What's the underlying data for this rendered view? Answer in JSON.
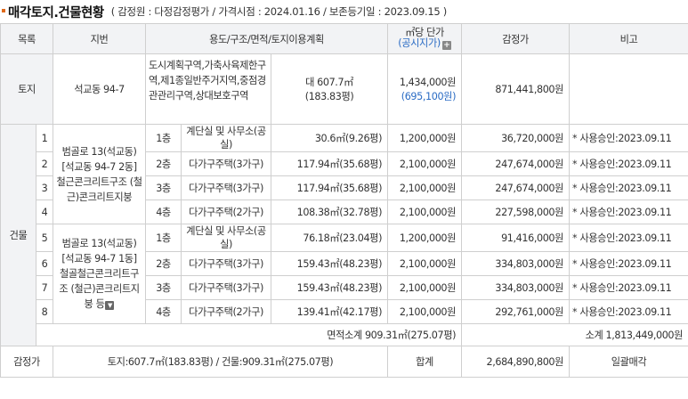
{
  "header": {
    "title": "매각토지.건물현황",
    "meta": "( 감정원 : 다정감정평가 / 가격시점 : 2024.01.16 / 보존등기일 : 2023.09.15 )"
  },
  "columns": {
    "catalog": "목록",
    "lot": "지번",
    "usage": "용도/구조/면적/토지이용계획",
    "unit_price": "㎡당 단가",
    "unit_price_sub": "(공시지가)",
    "appraisal": "감정가",
    "note": "비고"
  },
  "land": {
    "label": "토지",
    "lot": "석교동 94-7",
    "zoning": "도시계획구역,가축사육제한구역,제1종일반주거지역,중점경관관리구역,상대보호구역",
    "area": "대 607.7㎡",
    "area_pyeong": "(183.83평)",
    "unit_price": "1,434,000원",
    "official_price": "(695,100원)",
    "appraisal": "871,441,800원",
    "note": ""
  },
  "building": {
    "label": "건물",
    "group1_address": "범골로 13(석교동) [석교동 94-7 2동] 철근콘크리트구조 (철근)콘크리트지붕",
    "group2_address": "범골로 13(석교동) [석교동 94-7 1동] 철골철근콘크리트구조 (철근)콘크리트지붕 등",
    "rows": [
      {
        "no": "1",
        "floor": "1층",
        "use": "계단실 및 사무소(공실)",
        "area": "30.6㎡(9.26평)",
        "unit": "1,200,000원",
        "value": "36,720,000원",
        "note": "* 사용승인:2023.09.11"
      },
      {
        "no": "2",
        "floor": "2층",
        "use": "다가구주택(3가구)",
        "area": "117.94㎡(35.68평)",
        "unit": "2,100,000원",
        "value": "247,674,000원",
        "note": "* 사용승인:2023.09.11"
      },
      {
        "no": "3",
        "floor": "3층",
        "use": "다가구주택(3가구)",
        "area": "117.94㎡(35.68평)",
        "unit": "2,100,000원",
        "value": "247,674,000원",
        "note": "* 사용승인:2023.09.11"
      },
      {
        "no": "4",
        "floor": "4층",
        "use": "다가구주택(2가구)",
        "area": "108.38㎡(32.78평)",
        "unit": "2,100,000원",
        "value": "227,598,000원",
        "note": "* 사용승인:2023.09.11"
      },
      {
        "no": "5",
        "floor": "1층",
        "use": "계단실 및 사무소(공실)",
        "area": "76.18㎡(23.04평)",
        "unit": "1,200,000원",
        "value": "91,416,000원",
        "note": "* 사용승인:2023.09.11"
      },
      {
        "no": "6",
        "floor": "2층",
        "use": "다가구주택(3가구)",
        "area": "159.43㎡(48.23평)",
        "unit": "2,100,000원",
        "value": "334,803,000원",
        "note": "* 사용승인:2023.09.11"
      },
      {
        "no": "7",
        "floor": "3층",
        "use": "다가구주택(3가구)",
        "area": "159.43㎡(48.23평)",
        "unit": "2,100,000원",
        "value": "334,803,000원",
        "note": "* 사용승인:2023.09.11"
      },
      {
        "no": "8",
        "floor": "4층",
        "use": "다가구주택(2가구)",
        "area": "139.41㎡(42.17평)",
        "unit": "2,100,000원",
        "value": "292,761,000원",
        "note": "* 사용승인:2023.09.11"
      }
    ],
    "area_subtotal": "면적소계 909.31㎡(275.07평)",
    "value_subtotal": "소계 1,813,449,000원"
  },
  "appraisal_row": {
    "label": "감정가",
    "summary": "토지:607.7㎡(183.83평) / 건물:909.31㎡(275.07평)",
    "total_label": "합계",
    "total": "2,684,890,800원",
    "note": "일괄매각"
  }
}
